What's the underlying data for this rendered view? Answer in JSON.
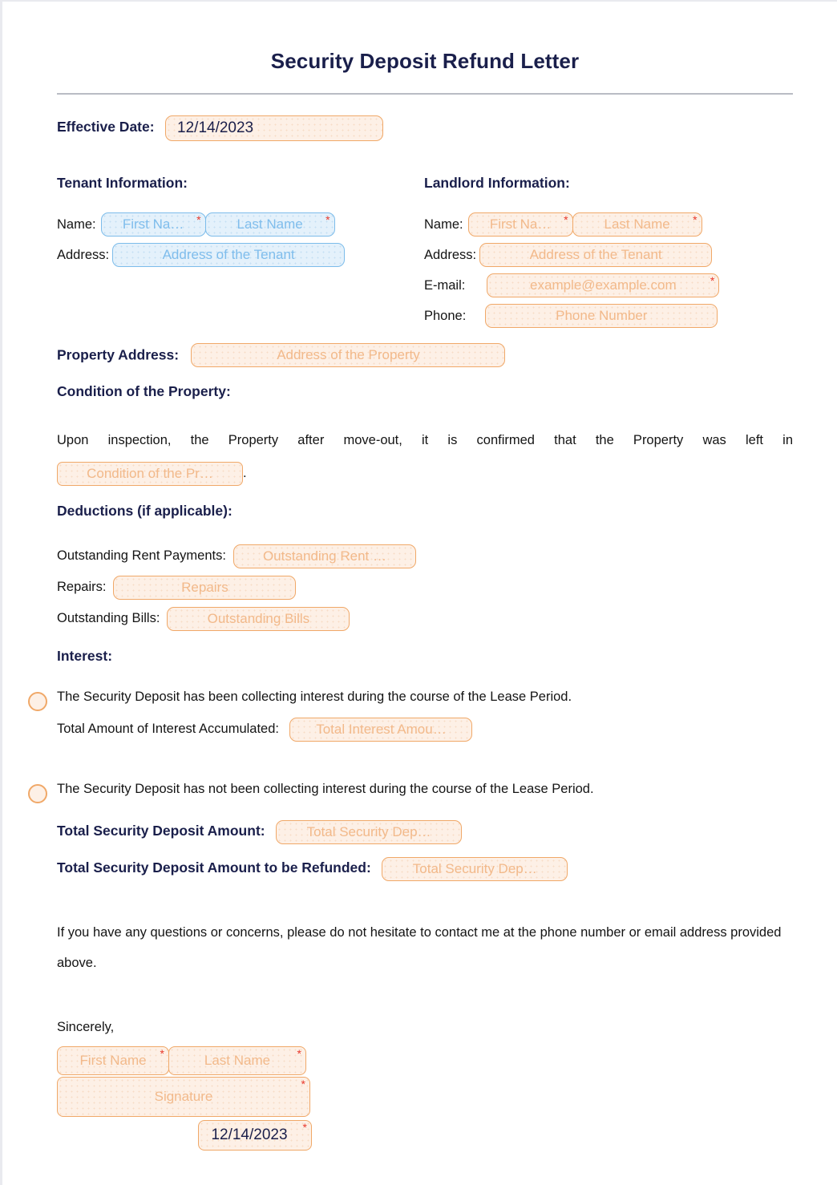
{
  "document": {
    "title": "Security Deposit Refund Letter"
  },
  "effective_date": {
    "label": "Effective Date:",
    "value": "12/14/2023"
  },
  "tenant": {
    "heading": "Tenant Information:",
    "name_label": "Name:",
    "address_label": "Address:",
    "first_name_placeholder": "First Na…",
    "last_name_placeholder": "Last Name",
    "address_placeholder": "Address of the Tenant",
    "required_marker": "*"
  },
  "landlord": {
    "heading": "Landlord Information:",
    "name_label": "Name:",
    "address_label": "Address:",
    "email_label": "E-mail:",
    "phone_label": "Phone:",
    "first_name_placeholder": "First Na…",
    "last_name_placeholder": "Last Name",
    "address_placeholder": "Address of the Tenant",
    "email_placeholder": "example@example.com",
    "phone_placeholder": "Phone Number",
    "required_marker": "*"
  },
  "property": {
    "address_label": "Property Address:",
    "address_placeholder": "Address of the Property"
  },
  "condition": {
    "heading": "Condition of the Property:",
    "paragraph_line1": "Upon inspection, the Property after move-out, it is confirmed that the Property was left in",
    "field_placeholder": "Condition of the Pr…",
    "paragraph_end": "."
  },
  "deductions": {
    "heading": "Deductions (if applicable):",
    "rent_label": "Outstanding Rent Payments:",
    "rent_placeholder": "Outstanding Rent …",
    "repairs_label": "Repairs:",
    "repairs_placeholder": "Repairs",
    "bills_label": "Outstanding Bills:",
    "bills_placeholder": "Outstanding Bills"
  },
  "interest": {
    "heading": "Interest:",
    "option_collecting": "The Security Deposit has been collecting interest during the course of the Lease Period.",
    "total_interest_label": "Total Amount of Interest Accumulated:",
    "total_interest_placeholder": "Total Interest Amou…",
    "option_not_collecting": "The Security Deposit has not been collecting interest during the course of the Lease Period."
  },
  "totals": {
    "deposit_label": "Total Security Deposit Amount:",
    "deposit_placeholder": "Total Security Dep…",
    "refund_label": "Total Security Deposit Amount to be Refunded:",
    "refund_placeholder": "Total Security Dep…"
  },
  "closing": {
    "paragraph": "If you have any questions or concerns, please do not hesitate to contact me at the phone number or email address provided above.",
    "sign_off": "Sincerely,"
  },
  "signature": {
    "first_name_placeholder": "First Name",
    "last_name_placeholder": "Last Name",
    "signature_placeholder": "Signature",
    "date_value": "12/14/2023",
    "required_marker": "*"
  },
  "colors": {
    "title": "#1a1f4b",
    "field_border_orange": "#f0a868",
    "field_fill_orange": "#fdf0e6",
    "field_text_orange": "#f2b98a",
    "field_border_blue": "#7cbcea",
    "field_fill_blue": "#e4f1fb",
    "field_text_blue": "#7fbdec",
    "required_asterisk": "#e8382b",
    "body_text": "#141414"
  }
}
